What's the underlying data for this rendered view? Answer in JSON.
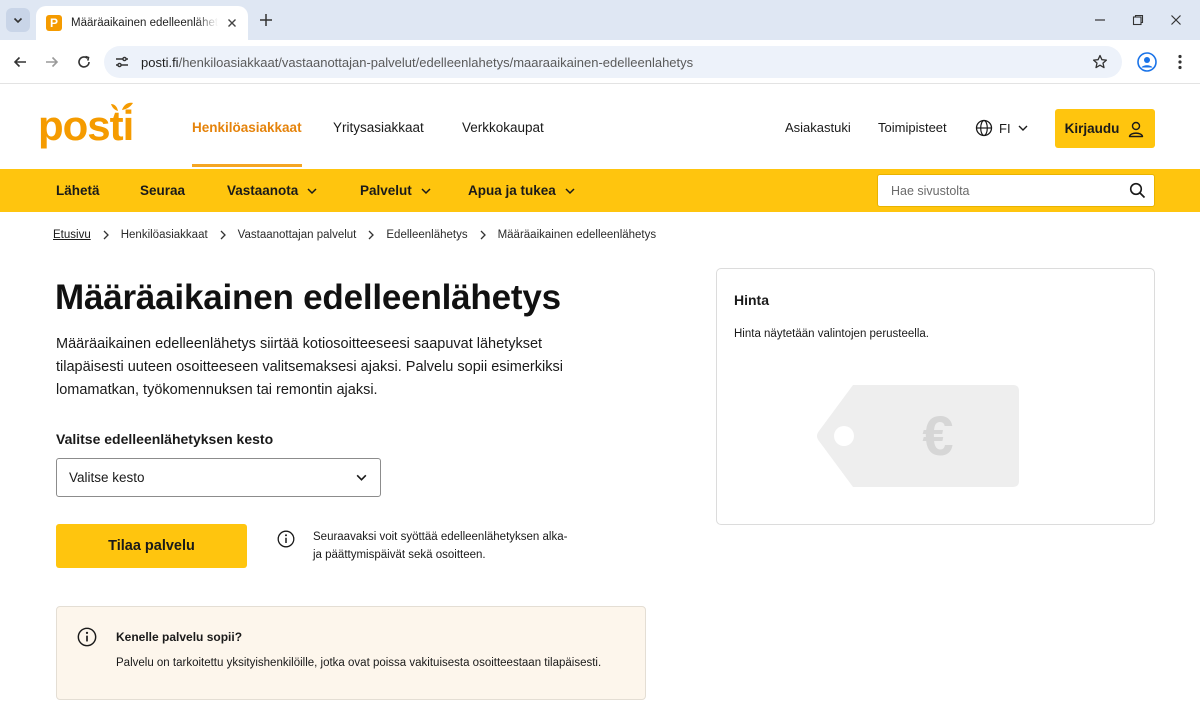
{
  "browser": {
    "tab_title": "Määräaikainen edelleenlähetys – Posti",
    "url_host": "posti.fi",
    "url_path": "/henkiloasiakkaat/vastaanottajan-palvelut/edelleenlahetys/maaraaikainen-edelleenlahetys"
  },
  "header": {
    "logo_text": "posti",
    "nav": [
      {
        "label": "Henkilöasiakkaat",
        "active": true
      },
      {
        "label": "Yritysasiakkaat"
      },
      {
        "label": "Verkkokaupat"
      }
    ],
    "support": "Asiakastuki",
    "locations": "Toimipisteet",
    "language": "FI",
    "login": "Kirjaudu"
  },
  "subnav": {
    "items": [
      {
        "label": "Lähetä"
      },
      {
        "label": "Seuraa"
      },
      {
        "label": "Vastaanota"
      },
      {
        "label": "Palvelut"
      },
      {
        "label": "Apua ja tukea"
      }
    ],
    "search_placeholder": "Hae sivustolta"
  },
  "breadcrumb": [
    "Etusivu",
    "Henkilöasiakkaat",
    "Vastaanottajan palvelut",
    "Edelleenlähetys",
    "Määräaikainen edelleenlähetys"
  ],
  "main": {
    "title": "Määräaikainen edelleenlähetys",
    "lead": "Määräaikainen edelleenlähetys siirtää kotiosoitteeseesi saapuvat lähetykset tilapäisesti uuteen osoitteeseen valitsemaksesi ajaksi. Palvelu sopii esimerkiksi lomamatkan, työkomennuksen tai remontin ajaksi.",
    "duration_label": "Valitse edelleenlähetyksen kesto",
    "duration_selected": "Valitse kesto",
    "order_button": "Tilaa palvelu",
    "hint": "Seuraavaksi voit syöttää edelleenlähetyksen alka- ja päättymispäivät sekä osoitteen.",
    "info_title": "Kenelle palvelu sopii?",
    "info_text": "Palvelu on tarkoitettu yksityishenkilöille, jotka ovat poissa vakituisesta osoitteestaan tilapäisesti."
  },
  "price": {
    "title": "Hinta",
    "text": "Hinta näytetään valintojen perusteella.",
    "tag_symbol": "€"
  },
  "colors": {
    "brand_yellow": "#ffc50e",
    "brand_orange": "#f59b00",
    "active_nav": "#e5830b"
  }
}
